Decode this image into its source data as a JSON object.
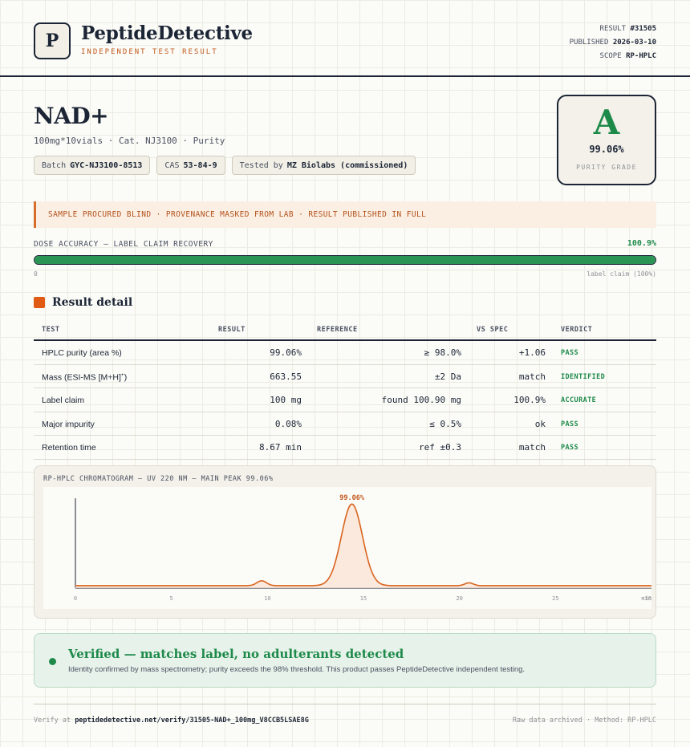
{
  "header": {
    "logo_letter": "P",
    "brand": "PeptideDetective",
    "tagline": "INDEPENDENT TEST RESULT",
    "result_label": "RESULT",
    "result_value": "#31505",
    "published_label": "PUBLISHED",
    "published_value": "2026-03-10",
    "scope_label": "SCOPE",
    "scope_value": "RP-HPLC"
  },
  "product": {
    "name": "NAD+",
    "subtitle": "100mg*10vials · Cat. NJ3100 · Purity",
    "chips": [
      {
        "label": "Batch",
        "value": "GYC-NJ3100-8513"
      },
      {
        "label": "CAS",
        "value": "53-84-9"
      },
      {
        "label": "Tested by",
        "value": "MZ Biolabs (commissioned)"
      }
    ]
  },
  "grade": {
    "letter": "A",
    "value": "99.06%",
    "label": "PURITY GRADE",
    "color": "#1e8a4a"
  },
  "banner": "SAMPLE PROCURED BLIND · PROVENANCE MASKED FROM LAB · RESULT PUBLISHED IN FULL",
  "dose": {
    "label": "DOSE ACCURACY — LABEL CLAIM RECOVERY",
    "value": "100.9%",
    "fill_fraction": 1.0,
    "min_label": "0",
    "max_label": "label claim (100%)"
  },
  "section_title": "Result detail",
  "table": {
    "headers": [
      "TEST",
      "RESULT",
      "REFERENCE",
      "VS SPEC",
      "VERDICT"
    ],
    "rows": [
      {
        "test": "HPLC purity (area %)",
        "result": "99.06%",
        "reference": "≥ 98.0%",
        "vs_spec": "+1.06",
        "verdict": "PASS"
      },
      {
        "test": "Mass (ESI-MS [M+H]",
        "test_sup": "+",
        "test_end": ")",
        "result": "663.55",
        "reference": "±2 Da",
        "vs_spec": "match",
        "verdict": "IDENTIFIED"
      },
      {
        "test": "Label claim",
        "result": "100 mg",
        "reference": "found 100.90 mg",
        "vs_spec": "100.9%",
        "verdict": "ACCURATE"
      },
      {
        "test": "Major impurity",
        "result": "0.08%",
        "reference": "≤ 0.5%",
        "vs_spec": "ok",
        "verdict": "PASS"
      },
      {
        "test": "Retention time",
        "result": "8.67 min",
        "reference": "ref ±0.3",
        "vs_spec": "match",
        "verdict": "PASS"
      }
    ]
  },
  "chromatogram": {
    "title": "RP-HPLC CHROMATOGRAM — UV 220 NM — MAIN PEAK 99.06%",
    "peak_label": "99.06%",
    "line_color": "#d9641f"
  },
  "chart_data": {
    "type": "line",
    "x_ticks": [
      "0",
      "5",
      "10",
      "15",
      "20",
      "25",
      "30"
    ],
    "x_unit_label": "min",
    "xlim": [
      0,
      30
    ],
    "peaks": [
      {
        "x": 9.7,
        "height": 0.06
      },
      {
        "x": 14.4,
        "height": 1.0,
        "label": "99.06%"
      },
      {
        "x": 20.5,
        "height": 0.035
      }
    ],
    "baseline": 0.03
  },
  "verified": {
    "title": "Verified — matches label, no adulterants detected",
    "description": "Identity confirmed by mass spectrometry; purity exceeds the 98% threshold. This product passes PeptideDetective independent testing."
  },
  "footer": {
    "verify_prefix": "Verify at",
    "verify_url": "peptidedetective.net/verify/31505-NAD+_100mg_V8CCB5LSAE8G",
    "right": "Raw data archived · Method: RP-HPLC"
  }
}
